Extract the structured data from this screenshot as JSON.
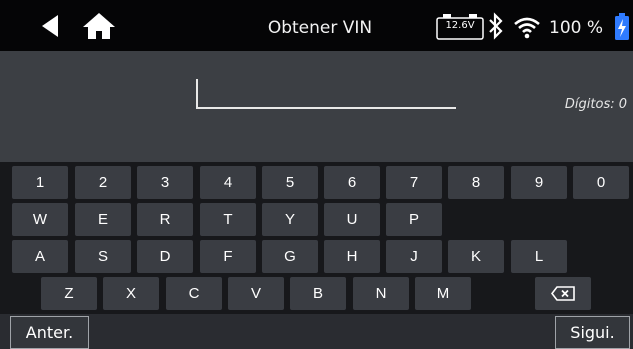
{
  "header": {
    "title": "Obtener VIN",
    "battery_voltage": "12.6V",
    "battery_percent": "100 %",
    "icons": [
      "back-arrow-icon",
      "home-icon",
      "battery-voltage-icon",
      "bluetooth-icon",
      "wifi-icon",
      "charging-icon"
    ]
  },
  "input": {
    "value": "",
    "digits_label": "Dígitos: 0"
  },
  "keyboard": {
    "row1": [
      "1",
      "2",
      "3",
      "4",
      "5",
      "6",
      "7",
      "8",
      "9",
      "0"
    ],
    "row2": [
      "W",
      "E",
      "R",
      "T",
      "Y",
      "U",
      "P"
    ],
    "row3": [
      "A",
      "S",
      "D",
      "F",
      "G",
      "H",
      "J",
      "K",
      "L"
    ],
    "row4": [
      "Z",
      "X",
      "C",
      "V",
      "B",
      "N",
      "M"
    ],
    "backspace_icon": "backspace-icon"
  },
  "footer": {
    "prev_label": "Anter.",
    "next_label": "Sigui."
  },
  "colors": {
    "accent_charge": "#2f7bff",
    "key_bg": "#3a3d43",
    "input_bg": "#3c3f44"
  }
}
